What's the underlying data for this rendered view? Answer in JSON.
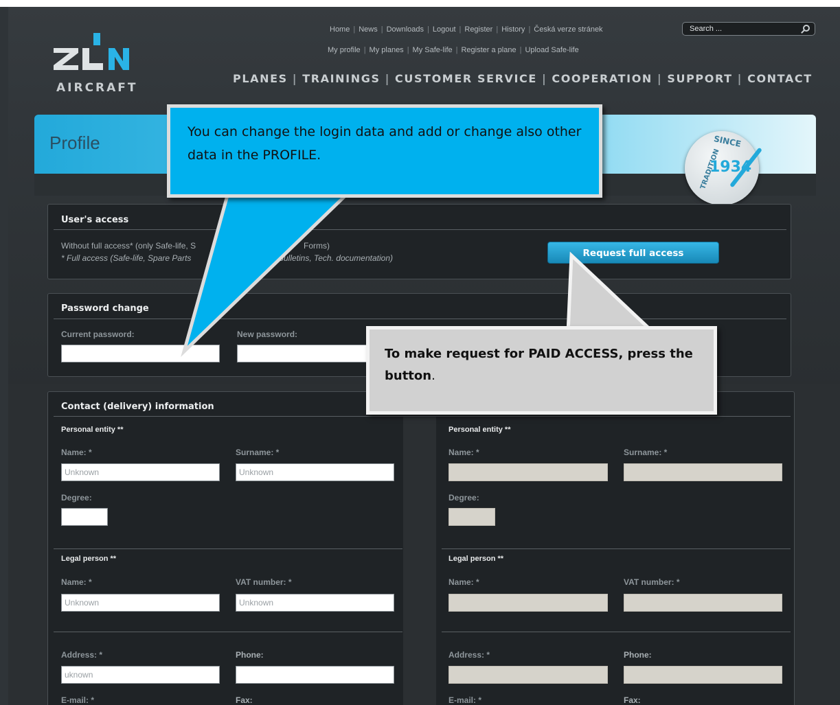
{
  "logo": {
    "word": "AIRCRAFT"
  },
  "top_links": [
    "Home",
    "News",
    "Downloads",
    "Logout",
    "Register",
    "History",
    "Česká verze stránek"
  ],
  "sub_links": [
    "My profile",
    "My planes",
    "My Safe-life",
    "Register a plane",
    "Upload Safe-life"
  ],
  "search": {
    "placeholder": "Search ..."
  },
  "main_nav": [
    "PLANES",
    "TRAININGS",
    "CUSTOMER SERVICE",
    "COOPERATION",
    "SUPPORT",
    "CONTACT"
  ],
  "banner": {
    "title": "Profile"
  },
  "medal": {
    "tradition": "TRADITION",
    "since": "SINCE",
    "year": "1934"
  },
  "users_access": {
    "title": "User's access",
    "line1": "Without full access* (only Safe-life, S",
    "line1b": "Forms)",
    "line2": "* Full access (Safe-life, Spare Parts",
    "line2b": "Bulletins, Tech. documentation)",
    "button": "Request full access"
  },
  "password": {
    "title": "Password change",
    "current_label": "Current password:",
    "new_label": "New password:"
  },
  "contact": {
    "title": "Contact (delivery) information",
    "personal": "Personal entity **",
    "name_label": "Name: *",
    "surname_label": "Surname: *",
    "degree_label": "Degree:",
    "legal": "Legal person **",
    "vat_label": "VAT number: *",
    "address_label": "Address: *",
    "phone_label": "Phone:",
    "email_label": "E-mail: *",
    "fax_label": "Fax:",
    "left_values": {
      "name": "Unknown",
      "surname": "Unknown",
      "legal_name": "Unknown",
      "vat": "Unknown",
      "address": "uknown"
    }
  },
  "callouts": {
    "blue": "You can change the login data and add or change also other data in the PROFILE.",
    "grey_bold": "To make request for PAID ACCESS, press the button",
    "grey_tail": "."
  }
}
